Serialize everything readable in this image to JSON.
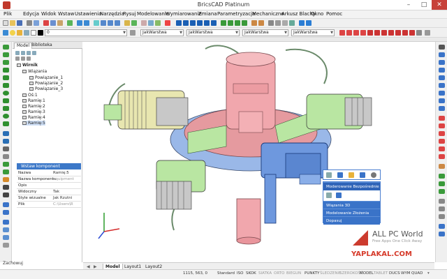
{
  "window": {
    "title": "BricsCAD Platinum",
    "minimize": "–",
    "maximize": "□",
    "close": "✕"
  },
  "menu": [
    "Plik",
    "Edycja",
    "Widok",
    "Wstaw",
    "Ustawienia",
    "Narzędzia",
    "Rysuj",
    "Modelowanie",
    "Wymiarowanie",
    "Zmiana",
    "Parametryzacja",
    "Mechaniczne",
    "Arkusz Blachy",
    "Okno",
    "Pomoc"
  ],
  "toolbar": {
    "layer_value": "0",
    "linetype_value": "JakWarstwa",
    "lineweight_value": "JakWarstwa",
    "linestyle_value": "JakWarstwa",
    "color_value": "JakWarstwa"
  },
  "panel": {
    "tabs": [
      "Model",
      "Biblioteka"
    ],
    "tree": {
      "root": "Wirnik",
      "group": "Wiązania",
      "constraints": [
        "Powiązanie_1",
        "Powiązanie_2",
        "Powiązanie_3"
      ],
      "parts": [
        "Oś:1",
        "Ramię:1",
        "Ramię:2",
        "Ramię:3",
        "Ramię:4",
        "Ramię:5"
      ]
    },
    "properties_header": "Wstaw komponent",
    "properties": [
      {
        "key": "Nazwa",
        "value": "Ramię:5"
      },
      {
        "key": "Nazwa komponentu",
        "value": "equipment"
      },
      {
        "key": "Opis",
        "value": ""
      },
      {
        "key": "Widoczny",
        "value": "Tak"
      },
      {
        "key": "Style wizualne",
        "value": "Jak Rzutni"
      },
      {
        "key": "Plik",
        "value": "C:\\Users\\R"
      }
    ]
  },
  "context_menu": {
    "items": [
      "Moderowanie Bezpośrednie",
      "Wiązania 3D",
      "Modelowanie Złożenia",
      "Dopasuj"
    ]
  },
  "layout_tabs": [
    "Model",
    "Layout1",
    "Layout2"
  ],
  "status": {
    "prompt": "Zachowuj",
    "coords": "1115, 563, 0",
    "items": [
      "Standard",
      "ISO",
      "SKOK",
      "SIATKA",
      "ORTO",
      "BIEGUN",
      "PUNKTY",
      "ŚLEDZENIE",
      "SZEROKOŚĆ",
      "MODEL",
      "TABLET",
      "DUCS",
      "WYM",
      "QUAD"
    ]
  },
  "watermark": {
    "line1": "ALL PC World",
    "line2": "Free Apps One Click Away",
    "line3": "YAPLAKAL.COM"
  },
  "colors": {
    "accent": "#3c78c8",
    "close": "#c7413a",
    "part_pink": "#f1a7ad",
    "part_blue": "#9ab8e8",
    "part_green": "#b9e6a2",
    "part_olive": "#e8e6b0",
    "part_gray": "#c8c8c8"
  }
}
